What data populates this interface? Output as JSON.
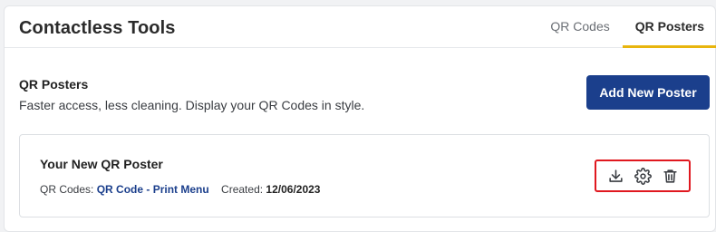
{
  "header": {
    "title": "Contactless Tools",
    "tabs": [
      {
        "label": "QR Codes",
        "active": false
      },
      {
        "label": "QR Posters",
        "active": true
      }
    ]
  },
  "section": {
    "title": "QR Posters",
    "subtitle": "Faster access, less cleaning. Display your QR Codes in style.",
    "add_button_label": "Add New Poster"
  },
  "poster_card": {
    "title": "Your New QR Poster",
    "qr_codes_label": "QR Codes:",
    "qr_code_link": "QR Code - Print Menu",
    "created_label": "Created:",
    "created_value": "12/06/2023",
    "actions": [
      {
        "icon": "download-icon"
      },
      {
        "icon": "gear-icon"
      },
      {
        "icon": "trash-icon"
      }
    ]
  },
  "colors": {
    "primary": "#1b3f8c",
    "active_tab_underline": "#e8b50e",
    "highlight_border": "#e0181f"
  }
}
